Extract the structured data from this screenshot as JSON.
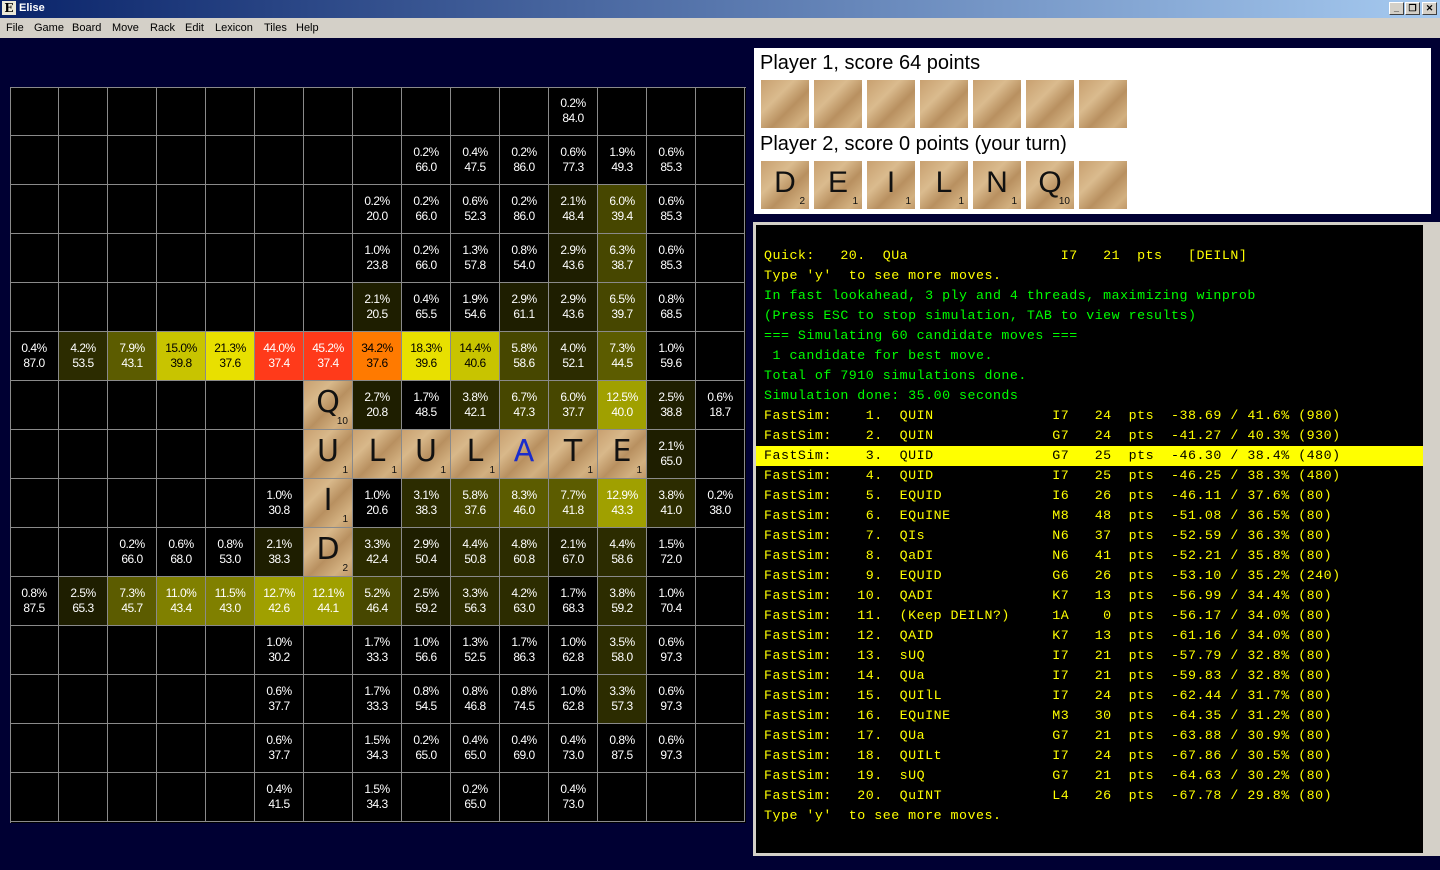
{
  "app": {
    "title": "Elise",
    "icon": "E"
  },
  "window_buttons": {
    "minimize": "_",
    "restore": "❐",
    "close": "✕"
  },
  "menu": [
    "File",
    "Game",
    "Board",
    "Move",
    "Rack",
    "Edit",
    "Lexicon",
    "Tiles",
    "Help"
  ],
  "board": {
    "cells": [
      {
        "r": 0,
        "c": 11,
        "p": "0.2%",
        "v": "84.0"
      },
      {
        "r": 1,
        "c": 8,
        "p": "0.2%",
        "v": "66.0"
      },
      {
        "r": 1,
        "c": 9,
        "p": "0.4%",
        "v": "47.5"
      },
      {
        "r": 1,
        "c": 10,
        "p": "0.2%",
        "v": "86.0"
      },
      {
        "r": 1,
        "c": 11,
        "p": "0.6%",
        "v": "77.3"
      },
      {
        "r": 1,
        "c": 12,
        "p": "1.9%",
        "v": "49.3"
      },
      {
        "r": 1,
        "c": 13,
        "p": "0.6%",
        "v": "85.3"
      },
      {
        "r": 2,
        "c": 7,
        "p": "0.2%",
        "v": "20.0"
      },
      {
        "r": 2,
        "c": 8,
        "p": "0.2%",
        "v": "66.0"
      },
      {
        "r": 2,
        "c": 9,
        "p": "0.6%",
        "v": "52.3"
      },
      {
        "r": 2,
        "c": 10,
        "p": "0.2%",
        "v": "86.0"
      },
      {
        "r": 2,
        "c": 11,
        "p": "2.1%",
        "v": "48.4"
      },
      {
        "r": 2,
        "c": 12,
        "p": "6.0%",
        "v": "39.4"
      },
      {
        "r": 2,
        "c": 13,
        "p": "0.6%",
        "v": "85.3"
      },
      {
        "r": 3,
        "c": 7,
        "p": "1.0%",
        "v": "23.8"
      },
      {
        "r": 3,
        "c": 8,
        "p": "0.2%",
        "v": "66.0"
      },
      {
        "r": 3,
        "c": 9,
        "p": "1.3%",
        "v": "57.8"
      },
      {
        "r": 3,
        "c": 10,
        "p": "0.8%",
        "v": "54.0"
      },
      {
        "r": 3,
        "c": 11,
        "p": "2.9%",
        "v": "43.6"
      },
      {
        "r": 3,
        "c": 12,
        "p": "6.3%",
        "v": "38.7"
      },
      {
        "r": 3,
        "c": 13,
        "p": "0.6%",
        "v": "85.3"
      },
      {
        "r": 4,
        "c": 7,
        "p": "2.1%",
        "v": "20.5"
      },
      {
        "r": 4,
        "c": 8,
        "p": "0.4%",
        "v": "65.5"
      },
      {
        "r": 4,
        "c": 9,
        "p": "1.9%",
        "v": "54.6"
      },
      {
        "r": 4,
        "c": 10,
        "p": "2.9%",
        "v": "61.1"
      },
      {
        "r": 4,
        "c": 11,
        "p": "2.9%",
        "v": "43.6"
      },
      {
        "r": 4,
        "c": 12,
        "p": "6.5%",
        "v": "39.7"
      },
      {
        "r": 4,
        "c": 13,
        "p": "0.8%",
        "v": "68.5"
      },
      {
        "r": 5,
        "c": 0,
        "p": "0.4%",
        "v": "87.0"
      },
      {
        "r": 5,
        "c": 1,
        "p": "4.2%",
        "v": "53.5"
      },
      {
        "r": 5,
        "c": 2,
        "p": "7.9%",
        "v": "43.1"
      },
      {
        "r": 5,
        "c": 3,
        "p": "15.0%",
        "v": "39.8"
      },
      {
        "r": 5,
        "c": 4,
        "p": "21.3%",
        "v": "37.6"
      },
      {
        "r": 5,
        "c": 5,
        "p": "44.0%",
        "v": "37.4"
      },
      {
        "r": 5,
        "c": 6,
        "p": "45.2%",
        "v": "37.4"
      },
      {
        "r": 5,
        "c": 7,
        "p": "34.2%",
        "v": "37.6"
      },
      {
        "r": 5,
        "c": 8,
        "p": "18.3%",
        "v": "39.6"
      },
      {
        "r": 5,
        "c": 9,
        "p": "14.4%",
        "v": "40.6"
      },
      {
        "r": 5,
        "c": 10,
        "p": "5.8%",
        "v": "58.6"
      },
      {
        "r": 5,
        "c": 11,
        "p": "4.0%",
        "v": "52.1"
      },
      {
        "r": 5,
        "c": 12,
        "p": "7.3%",
        "v": "44.5"
      },
      {
        "r": 5,
        "c": 13,
        "p": "1.0%",
        "v": "59.6"
      },
      {
        "r": 6,
        "c": 7,
        "p": "2.7%",
        "v": "20.8"
      },
      {
        "r": 6,
        "c": 8,
        "p": "1.7%",
        "v": "48.5"
      },
      {
        "r": 6,
        "c": 9,
        "p": "3.8%",
        "v": "42.1"
      },
      {
        "r": 6,
        "c": 10,
        "p": "6.7%",
        "v": "47.3"
      },
      {
        "r": 6,
        "c": 11,
        "p": "6.0%",
        "v": "37.7"
      },
      {
        "r": 6,
        "c": 12,
        "p": "12.5%",
        "v": "40.0"
      },
      {
        "r": 6,
        "c": 13,
        "p": "2.5%",
        "v": "38.8"
      },
      {
        "r": 6,
        "c": 14,
        "p": "0.6%",
        "v": "18.7"
      },
      {
        "r": 7,
        "c": 13,
        "p": "2.1%",
        "v": "65.0"
      },
      {
        "r": 8,
        "c": 5,
        "p": "1.0%",
        "v": "30.8"
      },
      {
        "r": 8,
        "c": 7,
        "p": "1.0%",
        "v": "20.6"
      },
      {
        "r": 8,
        "c": 8,
        "p": "3.1%",
        "v": "38.3"
      },
      {
        "r": 8,
        "c": 9,
        "p": "5.8%",
        "v": "37.6"
      },
      {
        "r": 8,
        "c": 10,
        "p": "8.3%",
        "v": "46.0"
      },
      {
        "r": 8,
        "c": 11,
        "p": "7.7%",
        "v": "41.8"
      },
      {
        "r": 8,
        "c": 12,
        "p": "12.9%",
        "v": "43.3"
      },
      {
        "r": 8,
        "c": 13,
        "p": "3.8%",
        "v": "41.0"
      },
      {
        "r": 8,
        "c": 14,
        "p": "0.2%",
        "v": "38.0"
      },
      {
        "r": 9,
        "c": 2,
        "p": "0.2%",
        "v": "66.0"
      },
      {
        "r": 9,
        "c": 3,
        "p": "0.6%",
        "v": "68.0"
      },
      {
        "r": 9,
        "c": 4,
        "p": "0.8%",
        "v": "53.0"
      },
      {
        "r": 9,
        "c": 5,
        "p": "2.1%",
        "v": "38.3"
      },
      {
        "r": 9,
        "c": 7,
        "p": "3.3%",
        "v": "42.4"
      },
      {
        "r": 9,
        "c": 8,
        "p": "2.9%",
        "v": "50.4"
      },
      {
        "r": 9,
        "c": 9,
        "p": "4.4%",
        "v": "50.8"
      },
      {
        "r": 9,
        "c": 10,
        "p": "4.8%",
        "v": "60.8"
      },
      {
        "r": 9,
        "c": 11,
        "p": "2.1%",
        "v": "67.0"
      },
      {
        "r": 9,
        "c": 12,
        "p": "4.4%",
        "v": "58.6"
      },
      {
        "r": 9,
        "c": 13,
        "p": "1.5%",
        "v": "72.0"
      },
      {
        "r": 10,
        "c": 0,
        "p": "0.8%",
        "v": "87.5"
      },
      {
        "r": 10,
        "c": 1,
        "p": "2.5%",
        "v": "65.3"
      },
      {
        "r": 10,
        "c": 2,
        "p": "7.3%",
        "v": "45.7"
      },
      {
        "r": 10,
        "c": 3,
        "p": "11.0%",
        "v": "43.4"
      },
      {
        "r": 10,
        "c": 4,
        "p": "11.5%",
        "v": "43.0"
      },
      {
        "r": 10,
        "c": 5,
        "p": "12.7%",
        "v": "42.6"
      },
      {
        "r": 10,
        "c": 6,
        "p": "12.1%",
        "v": "44.1"
      },
      {
        "r": 10,
        "c": 7,
        "p": "5.2%",
        "v": "46.4"
      },
      {
        "r": 10,
        "c": 8,
        "p": "2.5%",
        "v": "59.2"
      },
      {
        "r": 10,
        "c": 9,
        "p": "3.3%",
        "v": "56.3"
      },
      {
        "r": 10,
        "c": 10,
        "p": "4.2%",
        "v": "63.0"
      },
      {
        "r": 10,
        "c": 11,
        "p": "1.7%",
        "v": "68.3"
      },
      {
        "r": 10,
        "c": 12,
        "p": "3.8%",
        "v": "59.2"
      },
      {
        "r": 10,
        "c": 13,
        "p": "1.0%",
        "v": "70.4"
      },
      {
        "r": 11,
        "c": 5,
        "p": "1.0%",
        "v": "30.2"
      },
      {
        "r": 11,
        "c": 7,
        "p": "1.7%",
        "v": "33.3"
      },
      {
        "r": 11,
        "c": 8,
        "p": "1.0%",
        "v": "56.6"
      },
      {
        "r": 11,
        "c": 9,
        "p": "1.3%",
        "v": "52.5"
      },
      {
        "r": 11,
        "c": 10,
        "p": "1.7%",
        "v": "86.3"
      },
      {
        "r": 11,
        "c": 11,
        "p": "1.0%",
        "v": "62.8"
      },
      {
        "r": 11,
        "c": 12,
        "p": "3.5%",
        "v": "58.0"
      },
      {
        "r": 11,
        "c": 13,
        "p": "0.6%",
        "v": "97.3"
      },
      {
        "r": 12,
        "c": 5,
        "p": "0.6%",
        "v": "37.7"
      },
      {
        "r": 12,
        "c": 7,
        "p": "1.7%",
        "v": "33.3"
      },
      {
        "r": 12,
        "c": 8,
        "p": "0.8%",
        "v": "54.5"
      },
      {
        "r": 12,
        "c": 9,
        "p": "0.8%",
        "v": "46.8"
      },
      {
        "r": 12,
        "c": 10,
        "p": "0.8%",
        "v": "74.5"
      },
      {
        "r": 12,
        "c": 11,
        "p": "1.0%",
        "v": "62.8"
      },
      {
        "r": 12,
        "c": 12,
        "p": "3.3%",
        "v": "57.3"
      },
      {
        "r": 12,
        "c": 13,
        "p": "0.6%",
        "v": "97.3"
      },
      {
        "r": 13,
        "c": 5,
        "p": "0.6%",
        "v": "37.7"
      },
      {
        "r": 13,
        "c": 7,
        "p": "1.5%",
        "v": "34.3"
      },
      {
        "r": 13,
        "c": 8,
        "p": "0.2%",
        "v": "65.0"
      },
      {
        "r": 13,
        "c": 9,
        "p": "0.4%",
        "v": "65.0"
      },
      {
        "r": 13,
        "c": 10,
        "p": "0.4%",
        "v": "69.0"
      },
      {
        "r": 13,
        "c": 11,
        "p": "0.4%",
        "v": "73.0"
      },
      {
        "r": 13,
        "c": 12,
        "p": "0.8%",
        "v": "87.5"
      },
      {
        "r": 13,
        "c": 13,
        "p": "0.6%",
        "v": "97.3"
      },
      {
        "r": 14,
        "c": 5,
        "p": "0.4%",
        "v": "41.5"
      },
      {
        "r": 14,
        "c": 7,
        "p": "1.5%",
        "v": "34.3"
      },
      {
        "r": 14,
        "c": 9,
        "p": "0.2%",
        "v": "65.0"
      },
      {
        "r": 14,
        "c": 11,
        "p": "0.4%",
        "v": "73.0"
      }
    ],
    "tiles": [
      {
        "r": 6,
        "c": 6,
        "letter": "Q",
        "points": "10",
        "color": "#111111"
      },
      {
        "r": 7,
        "c": 6,
        "letter": "U",
        "points": "1",
        "color": "#111111"
      },
      {
        "r": 7,
        "c": 7,
        "letter": "L",
        "points": "1",
        "color": "#111111"
      },
      {
        "r": 7,
        "c": 8,
        "letter": "U",
        "points": "1",
        "color": "#111111"
      },
      {
        "r": 7,
        "c": 9,
        "letter": "L",
        "points": "1",
        "color": "#111111"
      },
      {
        "r": 7,
        "c": 10,
        "letter": "A",
        "points": "",
        "color": "#1a2ccc"
      },
      {
        "r": 7,
        "c": 11,
        "letter": "T",
        "points": "1",
        "color": "#111111"
      },
      {
        "r": 7,
        "c": 12,
        "letter": "E",
        "points": "1",
        "color": "#111111"
      },
      {
        "r": 8,
        "c": 6,
        "letter": "I",
        "points": "1",
        "color": "#111111"
      },
      {
        "r": 9,
        "c": 6,
        "letter": "D",
        "points": "2",
        "color": "#111111"
      }
    ]
  },
  "players": {
    "p1_label": "Player  1,  score  64  points",
    "p1_rack": [
      {
        "l": "",
        "p": ""
      },
      {
        "l": "",
        "p": ""
      },
      {
        "l": "",
        "p": ""
      },
      {
        "l": "",
        "p": ""
      },
      {
        "l": "",
        "p": ""
      },
      {
        "l": "",
        "p": ""
      },
      {
        "l": "",
        "p": ""
      }
    ],
    "p2_label": "Player  2,  score  0  points  (your  turn)",
    "p2_rack": [
      {
        "l": "D",
        "p": "2"
      },
      {
        "l": "E",
        "p": "1"
      },
      {
        "l": "I",
        "p": "1"
      },
      {
        "l": "L",
        "p": "1"
      },
      {
        "l": "N",
        "p": "1"
      },
      {
        "l": "Q",
        "p": "10"
      },
      {
        "l": "",
        "p": ""
      }
    ]
  },
  "console": {
    "lines": [
      {
        "t": "Quick:   20.  QUa                  I7   21  pts   [DEILN]",
        "c": "#ffff00"
      },
      {
        "t": "Type 'y'  to see more moves.",
        "c": "#ffff00"
      },
      {
        "t": "In fast lookahead, 3 ply and 4 threads, maximizing winprob",
        "c": "#00ff00"
      },
      {
        "t": "(Press ESC to stop simulation, TAB to view results)",
        "c": "#00ff00"
      },
      {
        "t": "=== Simulating 60 candidate moves ===",
        "c": "#00ff00"
      },
      {
        "t": " 1 candidate for best move.",
        "c": "#00ff00"
      },
      {
        "t": "Total of 7910 simulations done.",
        "c": "#00ff00"
      },
      {
        "t": "Simulation done: 35.00 seconds",
        "c": "#00ff00"
      },
      {
        "t": "FastSim:    1.  QUIN              I7   24  pts  -38.69 / 41.6% (980)",
        "c": "#ffff00"
      },
      {
        "t": "FastSim:    2.  QUIN              G7   24  pts  -41.27 / 40.3% (930)",
        "c": "#ffff00"
      },
      {
        "t": "FastSim:    3.  QUID              G7   25  pts  -46.30 / 38.4% (480)",
        "c": "#000000",
        "hl": true
      },
      {
        "t": "FastSim:    4.  QUID              I7   25  pts  -46.25 / 38.3% (480)",
        "c": "#ffff00"
      },
      {
        "t": "FastSim:    5.  EQUID             I6   26  pts  -46.11 / 37.6% (80)",
        "c": "#ffff00"
      },
      {
        "t": "FastSim:    6.  EQuINE            M8   48  pts  -51.08 / 36.5% (80)",
        "c": "#ffff00"
      },
      {
        "t": "FastSim:    7.  QIs               N6   37  pts  -52.59 / 36.3% (80)",
        "c": "#ffff00"
      },
      {
        "t": "FastSim:    8.  QaDI              N6   41  pts  -52.21 / 35.8% (80)",
        "c": "#ffff00"
      },
      {
        "t": "FastSim:    9.  EQUID             G6   26  pts  -53.10 / 35.2% (240)",
        "c": "#ffff00"
      },
      {
        "t": "FastSim:   10.  QADI              K7   13  pts  -56.99 / 34.4% (80)",
        "c": "#ffff00"
      },
      {
        "t": "FastSim:   11.  (Keep DEILN?)     1A    0  pts  -56.17 / 34.0% (80)",
        "c": "#ffff00"
      },
      {
        "t": "FastSim:   12.  QAID              K7   13  pts  -61.16 / 34.0% (80)",
        "c": "#ffff00"
      },
      {
        "t": "FastSim:   13.  sUQ               I7   21  pts  -57.79 / 32.8% (80)",
        "c": "#ffff00"
      },
      {
        "t": "FastSim:   14.  QUa               I7   21  pts  -59.83 / 32.8% (80)",
        "c": "#ffff00"
      },
      {
        "t": "FastSim:   15.  QUIlL             I7   24  pts  -62.44 / 31.7% (80)",
        "c": "#ffff00"
      },
      {
        "t": "FastSim:   16.  EQuINE            M3   30  pts  -64.35 / 31.2% (80)",
        "c": "#ffff00"
      },
      {
        "t": "FastSim:   17.  QUa               G7   21  pts  -63.88 / 30.9% (80)",
        "c": "#ffff00"
      },
      {
        "t": "FastSim:   18.  QUILt             I7   24  pts  -67.86 / 30.5% (80)",
        "c": "#ffff00"
      },
      {
        "t": "FastSim:   19.  sUQ               G7   21  pts  -64.63 / 30.2% (80)",
        "c": "#ffff00"
      },
      {
        "t": "FastSim:   20.  QuINT             L4   26  pts  -67.78 / 29.8% (80)",
        "c": "#ffff00"
      },
      {
        "t": "Type 'y'  to see more moves.",
        "c": "#ffff00"
      }
    ]
  }
}
